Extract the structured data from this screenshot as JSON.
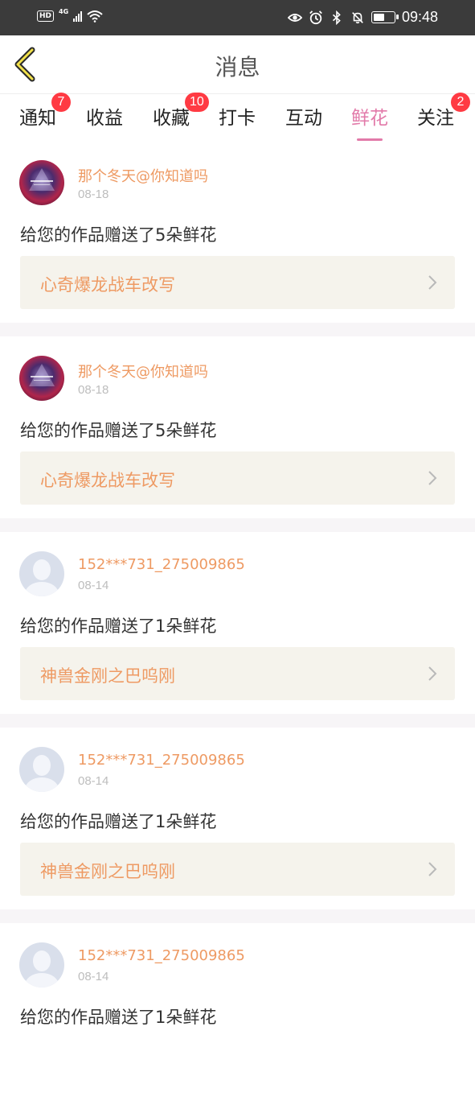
{
  "status_bar": {
    "hd": "HD",
    "network": "4G",
    "time": "09:48",
    "battery_level": 0.6
  },
  "header": {
    "title": "消息"
  },
  "tabs": [
    {
      "label": "通知",
      "badge": "7"
    },
    {
      "label": "收益",
      "badge": ""
    },
    {
      "label": "收藏",
      "badge": "10"
    },
    {
      "label": "打卡",
      "badge": ""
    },
    {
      "label": "互动",
      "badge": ""
    },
    {
      "label": "鲜花",
      "badge": "",
      "active": true
    },
    {
      "label": "关注",
      "badge": "2"
    }
  ],
  "feed": [
    {
      "name": "那个冬天@你知道吗",
      "date": "08-18",
      "message": "给您的作品赠送了5朵鲜花",
      "work": "心奇爆龙战车改写",
      "avatar": "galaxy"
    },
    {
      "name": "那个冬天@你知道吗",
      "date": "08-18",
      "message": "给您的作品赠送了5朵鲜花",
      "work": "心奇爆龙战车改写",
      "avatar": "galaxy"
    },
    {
      "name": "152***731_275009865",
      "date": "08-14",
      "message": "给您的作品赠送了1朵鲜花",
      "work": "神兽金刚之巴呜刚",
      "avatar": "default"
    },
    {
      "name": "152***731_275009865",
      "date": "08-14",
      "message": "给您的作品赠送了1朵鲜花",
      "work": "神兽金刚之巴呜刚",
      "avatar": "default"
    },
    {
      "name": "152***731_275009865",
      "date": "08-14",
      "message": "给您的作品赠送了1朵鲜花",
      "work": "",
      "avatar": "default"
    }
  ],
  "colors": {
    "accent_pink": "#e27aa9",
    "name_orange": "#ee9a63",
    "badge_red": "#ff3a43"
  }
}
